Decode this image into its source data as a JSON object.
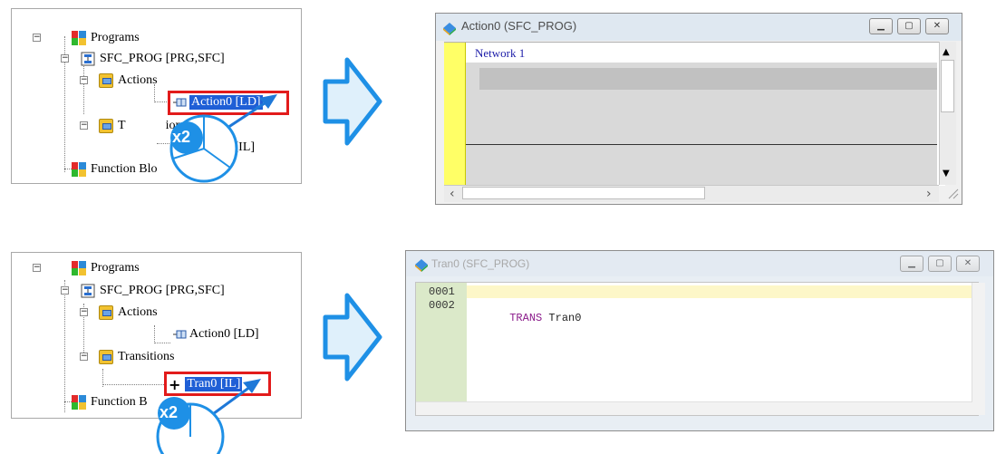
{
  "top_tree": {
    "programs_label": "Programs",
    "sfc_prog_label": "SFC_PROG [PRG,SFC]",
    "actions_label": "Actions",
    "action0_label": "Action0 [LD]",
    "transitions_label": "T",
    "transitions_label_tail": "ions",
    "tran0_label": "Tran0 [IL]",
    "tran0_partial": "n0 [IL]",
    "function_blocks_label": "Function Blo",
    "callout_badge": "x2"
  },
  "bottom_tree": {
    "programs_label": "Programs",
    "sfc_prog_label": "SFC_PROG [PRG,SFC]",
    "actions_label": "Actions",
    "action0_label": "Action0 [LD]",
    "transitions_label": "Transitions",
    "tran0_label": "Tran0 [IL]",
    "function_blocks_label": "Function B",
    "callout_badge": "x2"
  },
  "ld_window": {
    "title": "Action0 (SFC_PROG)",
    "network_label": "Network 1"
  },
  "il_window": {
    "title": "Tran0 (SFC_PROG)",
    "lines": [
      {
        "num": "0001",
        "keyword": "",
        "text": ""
      },
      {
        "num": "0002",
        "keyword": "TRANS",
        "text": " Tran0"
      }
    ]
  },
  "colors": {
    "arrow_fill": "#dff0fb",
    "arrow_stroke": "#1e90e6",
    "highlight_red": "#e21b1b",
    "selection_blue": "#1f5fd6",
    "ld_gutter_yellow": "#ffff66",
    "il_line_highlight": "#fdf7c8",
    "il_gutter_green": "#dbe9c9"
  }
}
